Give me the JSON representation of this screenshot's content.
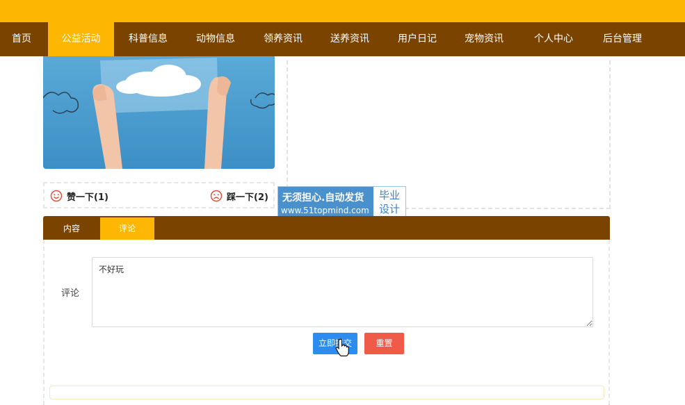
{
  "nav": {
    "items": [
      {
        "label": "首页"
      },
      {
        "label": "公益活动"
      },
      {
        "label": "科普信息"
      },
      {
        "label": "动物信息"
      },
      {
        "label": "领养资讯"
      },
      {
        "label": "送养资讯"
      },
      {
        "label": "用户日记"
      },
      {
        "label": "宠物资讯"
      },
      {
        "label": "个人中心"
      },
      {
        "label": "后台管理"
      }
    ],
    "active_index": 1
  },
  "image": {
    "icon": "hands-holding-cloud-photo"
  },
  "votes": {
    "like_label": "赞一下(1)",
    "dislike_label": "踩一下(2)",
    "like_icon": "smile-face-icon",
    "dislike_icon": "frown-face-icon"
  },
  "watermark": {
    "line1": "无须担心.自动发货",
    "line2": "www.51topmind.com",
    "side1": "毕业",
    "side2": "设计"
  },
  "tabs": [
    {
      "label": "内容"
    },
    {
      "label": "评论"
    }
  ],
  "comment": {
    "label": "评论",
    "value": "不好玩"
  },
  "buttons": {
    "submit": "立即提交",
    "reset": "重置"
  },
  "colors": {
    "topbar": "#fdb702",
    "nav": "#7a4400",
    "submit": "#2d8cf0",
    "reset": "#f05b49"
  }
}
